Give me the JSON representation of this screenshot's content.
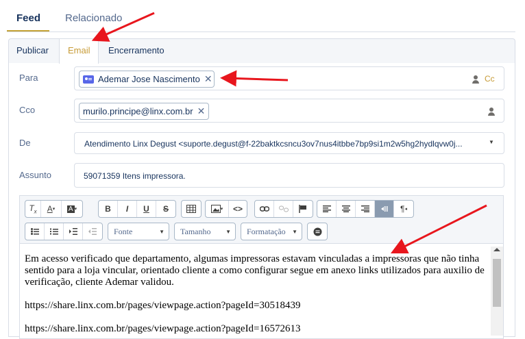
{
  "top_tabs": {
    "feed": "Feed",
    "related": "Relacionado"
  },
  "sub_tabs": {
    "publish": "Publicar",
    "email": "Email",
    "closing": "Encerramento"
  },
  "form": {
    "to_label": "Para",
    "to_recipient": "Ademar Jose Nascimento",
    "cc_link": "Cc",
    "bcc_label": "Cco",
    "bcc_recipient": "murilo.principe@linx.com.br",
    "from_label": "De",
    "from_value": "Atendimento Linx Degust <suporte.degust@f-22baktkcsncu3ov7nus4itbbe7bp9si1m2w5hg2hydlqvw0j...",
    "subject_label": "Assunto",
    "subject_value": "59071359 Itens impressora."
  },
  "toolbar": {
    "row1": [
      {
        "name": "clear-format-button",
        "glyph": "Tx"
      },
      {
        "name": "text-color-button",
        "glyph": "A▾"
      },
      {
        "name": "background-color-button",
        "glyph": "A▾"
      },
      {
        "name": "bold-button",
        "glyph": "B"
      },
      {
        "name": "italic-button",
        "glyph": "I"
      },
      {
        "name": "underline-button",
        "glyph": "U"
      },
      {
        "name": "strikethrough-button",
        "glyph": "S"
      },
      {
        "name": "table-button",
        "glyph": "▦"
      },
      {
        "name": "image-button",
        "glyph": "▣▾"
      },
      {
        "name": "source-code-button",
        "glyph": "<>"
      },
      {
        "name": "link-button",
        "glyph": "🔗"
      },
      {
        "name": "unlink-button",
        "glyph": "⊘"
      },
      {
        "name": "anchor-button",
        "glyph": "⚑"
      },
      {
        "name": "align-left-button",
        "glyph": "≡"
      },
      {
        "name": "align-center-button",
        "glyph": "≡"
      },
      {
        "name": "align-right-button",
        "glyph": "≡"
      },
      {
        "name": "text-direction-button",
        "glyph": "⇄"
      },
      {
        "name": "paragraph-button",
        "glyph": "¶"
      }
    ],
    "font_select": "Fonte",
    "size_select": "Tamanho",
    "format_select": "Formatação"
  },
  "body": {
    "paragraph1": "Em acesso verificado que departamento, algumas impressoras estavam vinculadas a impressoras que não tinha sentido para a loja vincular, orientado cliente a como configurar segue em anexo links utilizados para auxilio de verificação, cliente Ademar validou.",
    "link1": "https://share.linx.com.br/pages/viewpage.action?pageId=30518439",
    "link2": "https://share.linx.com.br/pages/viewpage.action?pageId=16572613"
  },
  "colors": {
    "accent": "#c79b36",
    "arrow": "#e8161d",
    "contact_icon": "#5867e8"
  }
}
